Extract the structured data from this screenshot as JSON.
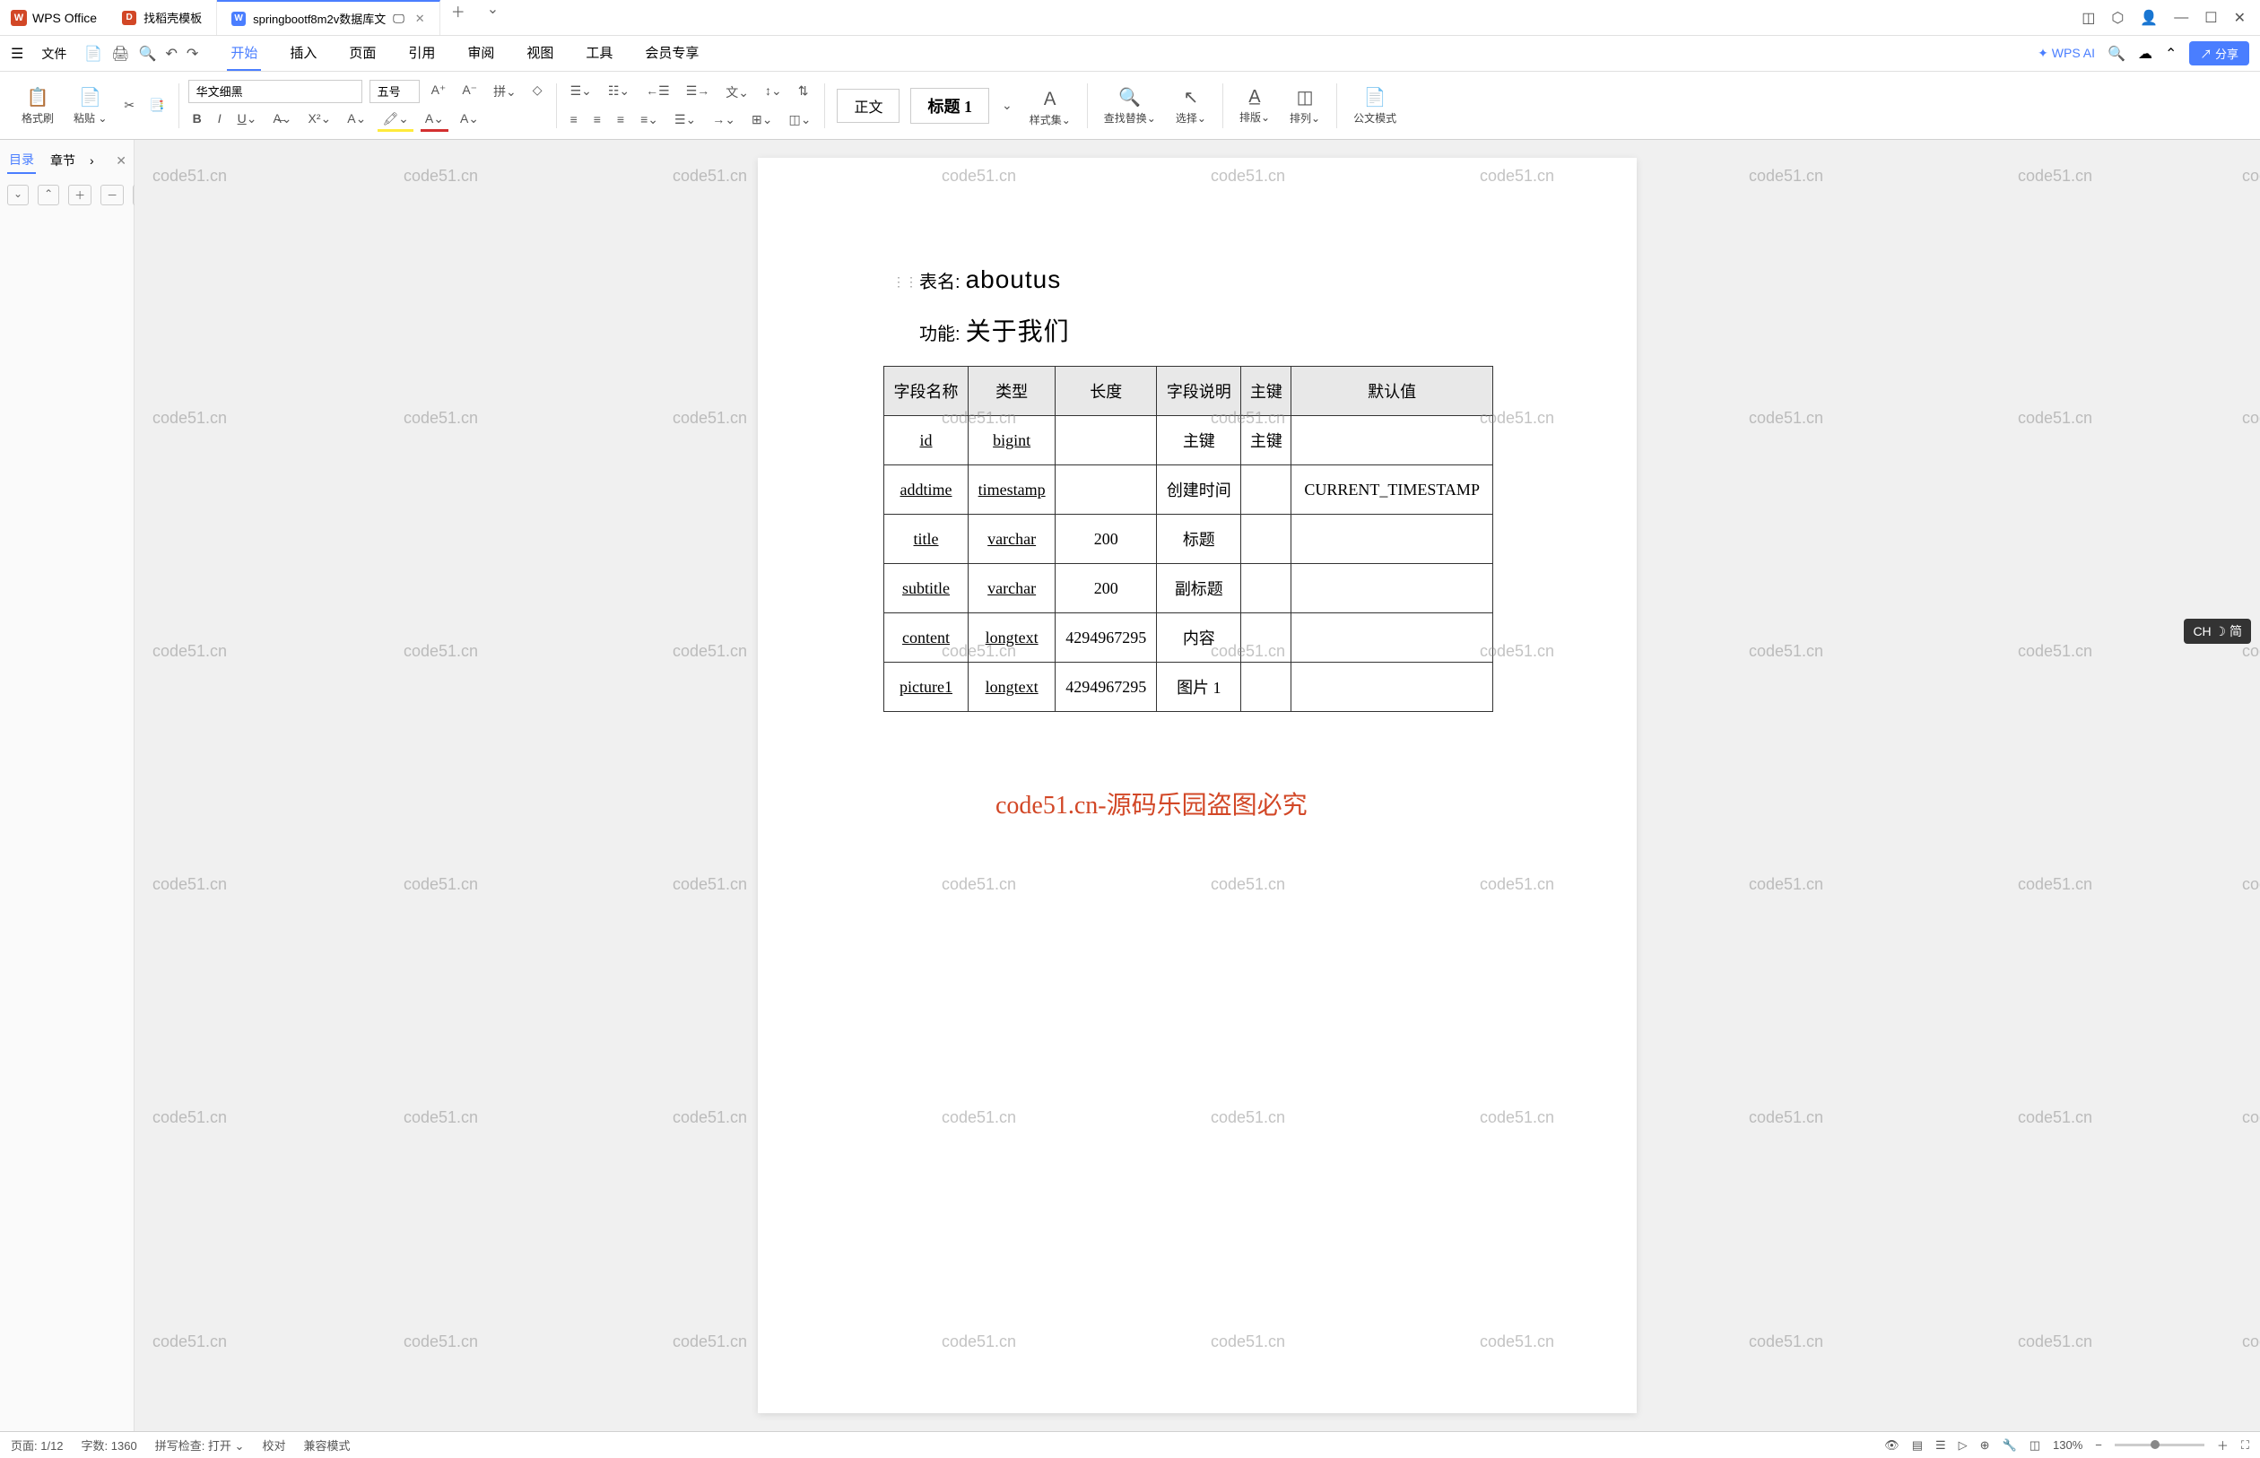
{
  "app": {
    "name": "WPS Office"
  },
  "tabs": [
    {
      "label": "找稻壳模板",
      "icon_color": "red"
    },
    {
      "label": "springbootf8m2v数据库文",
      "icon_color": "blue",
      "active": true
    }
  ],
  "window_controls": {
    "min": "—",
    "max": "☐",
    "close": "✕"
  },
  "menubar": {
    "file": "文件",
    "items": [
      "开始",
      "插入",
      "页面",
      "引用",
      "审阅",
      "视图",
      "工具",
      "会员专享"
    ],
    "active": "开始",
    "wps_ai": "WPS AI",
    "share": "分享"
  },
  "ribbon": {
    "format_painter": "格式刷",
    "paste": "粘贴",
    "font_name": "华文细黑",
    "font_size": "五号",
    "style_normal": "正文",
    "style_heading": "标题 1",
    "style_set": "样式集",
    "find_replace": "查找替换",
    "select": "选择",
    "layout": "排版",
    "arrange": "排列",
    "fullwidth": "公文模式"
  },
  "sidebar": {
    "toc": "目录",
    "chapter": "章节"
  },
  "document": {
    "table_name_label": "表名:",
    "table_name_value": "aboutus",
    "function_label": "功能:",
    "function_value": "关于我们",
    "headers": [
      "字段名称",
      "类型",
      "长度",
      "字段说明",
      "主键",
      "默认值"
    ],
    "rows": [
      {
        "name": "id",
        "type": "bigint",
        "length": "",
        "desc": "主键",
        "pk": "主键",
        "default": ""
      },
      {
        "name": "addtime",
        "type": "timestamp",
        "length": "",
        "desc": "创建时间",
        "pk": "",
        "default": "CURRENT_TIMESTAMP"
      },
      {
        "name": "title",
        "type": "varchar",
        "length": "200",
        "desc": "标题",
        "pk": "",
        "default": ""
      },
      {
        "name": "subtitle",
        "type": "varchar",
        "length": "200",
        "desc": "副标题",
        "pk": "",
        "default": ""
      },
      {
        "name": "content",
        "type": "longtext",
        "length": "4294967295",
        "desc": "内容",
        "pk": "",
        "default": ""
      },
      {
        "name": "picture1",
        "type": "longtext",
        "length": "4294967295",
        "desc": "图片 1",
        "pk": "",
        "default": ""
      }
    ]
  },
  "watermark": {
    "text": "code51.cn",
    "center": "code51.cn-源码乐园盗图必究"
  },
  "statusbar": {
    "page": "页面: 1/12",
    "words": "字数: 1360",
    "spellcheck": "拼写检查: 打开",
    "proofread": "校对",
    "compat": "兼容模式",
    "zoom": "130%"
  },
  "ime": "CH ☽ 简"
}
